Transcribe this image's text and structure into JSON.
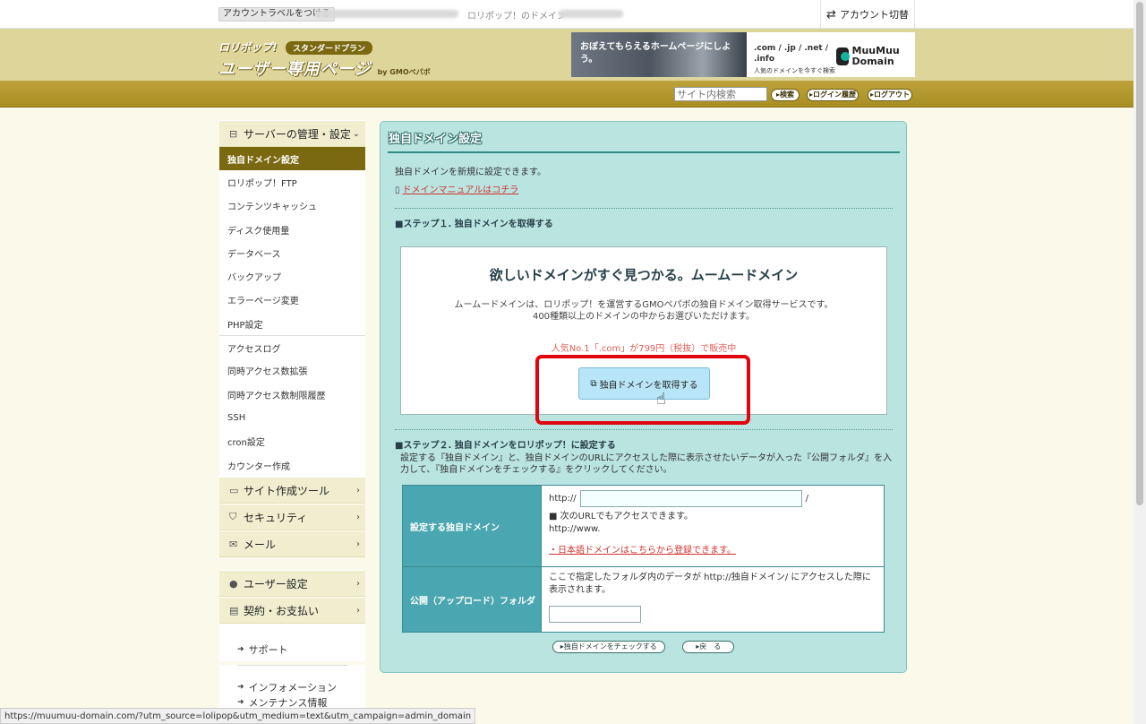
{
  "topbar": {
    "label_tag": "アカウントラベルをつける",
    "lolipop_domain": "ロリポップ！のドメイン",
    "switch_account": "アカウント切替"
  },
  "header": {
    "brand": "ロリポップ!",
    "plan": "スタンダードプラン",
    "title": "ユーザー専用ページ",
    "by": "by GMOペパボ",
    "banner_text": "おぼえてもらえるホームページにしよう。",
    "banner_tlds": ".com / .jp / .net / .info",
    "banner_sub": "人気のドメインを今すぐ検索",
    "banner_brand": "MuuMuu Domain"
  },
  "nav": {
    "search_placeholder": "サイト内検索",
    "search_btn": "▸検索",
    "login_history": "▸ログイン履歴",
    "logout": "▸ログアウト"
  },
  "sidebar": {
    "server_section": "サーバーの管理・設定",
    "items": [
      "独自ドメイン設定",
      "ロリポップ！FTP",
      "コンテンツキャッシュ",
      "ディスク使用量",
      "データベース",
      "バックアップ",
      "エラーページ変更",
      "PHP設定",
      "アクセスログ",
      "同時アクセス数拡張",
      "同時アクセス数制限履歴",
      "SSH",
      "cron設定",
      "カウンター作成"
    ],
    "sections": [
      "サイト作成ツール",
      "セキュリティ",
      "メール",
      "ユーザー設定",
      "契約・お支払い"
    ],
    "links": [
      "サポート",
      "インフォメーション",
      "メンテナンス情報"
    ]
  },
  "main": {
    "title": "独自ドメイン設定",
    "intro": "独自ドメインを新規に設定できます。",
    "manual_link": "ドメインマニュアルはコチラ",
    "step1": "■ステップ１. 独自ドメインを取得する",
    "promo_heading": "欲しいドメインがすぐ見つかる。ムームードメイン",
    "promo_desc1": "ムームードメインは、ロリポップ！を運営するGMOペパボの独自ドメイン取得サービスです。",
    "promo_desc2": "400種類以上のドメインの中からお選びいただけます。",
    "promo_sale": "人気No.1「.com」が799円（税抜）で販売中",
    "get_button": "独自ドメインを取得する",
    "step2": "■ステップ２. 独自ドメインをロリポップ！に設定する",
    "step2_desc": "設定する『独自ドメイン』と、独自ドメインのURLにアクセスした際に表示させたいデータが入った『公開フォルダ』を入力して、『独自ドメインをチェックする』をクリックしてください。",
    "row1_label": "設定する独自ドメイン",
    "http_prefix": "http://",
    "slash": "/",
    "also_access": "■ 次のURLでもアクセスできます。",
    "www_prefix": "http://www.",
    "jp_domain_link": "・日本語ドメインはこちらから登録できます。",
    "row2_label": "公開（アップロード）フォルダ",
    "folder_desc": "ここで指定したフォルダ内のデータが http://独自ドメイン/ にアクセスした際に表示されます。",
    "check_btn": "▸独自ドメインをチェックする",
    "back_btn": "▸戻　る"
  },
  "status_url": "https://muumuu-domain.com/?utm_source=lolipop&utm_medium=text&utm_campaign=admin_domain"
}
